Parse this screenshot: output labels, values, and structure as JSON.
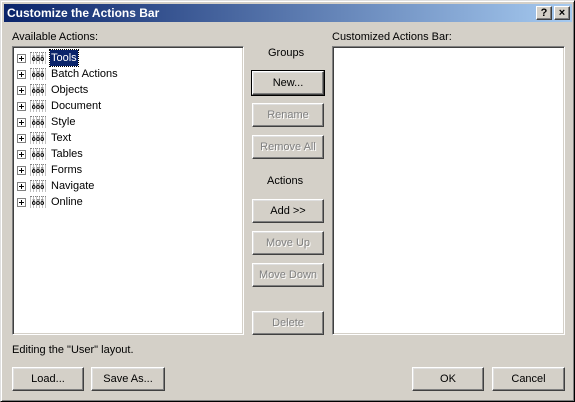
{
  "window": {
    "title": "Customize the Actions Bar",
    "help_glyph": "?",
    "close_glyph": "×"
  },
  "available": {
    "label": "Available Actions:",
    "items": [
      {
        "label": "Tools",
        "selected": true
      },
      {
        "label": "Batch Actions"
      },
      {
        "label": "Objects"
      },
      {
        "label": "Document"
      },
      {
        "label": "Style"
      },
      {
        "label": "Text"
      },
      {
        "label": "Tables"
      },
      {
        "label": "Forms"
      },
      {
        "label": "Navigate"
      },
      {
        "label": "Online"
      }
    ],
    "group_icon_glyph": "ŏőö"
  },
  "customized": {
    "label": "Customized Actions Bar:"
  },
  "groups": {
    "heading": "Groups",
    "new": "New...",
    "rename": "Rename",
    "remove_all": "Remove All"
  },
  "actions": {
    "heading": "Actions",
    "add": "Add  >>",
    "move_up": "Move Up",
    "move_down": "Move Down",
    "delete": "Delete"
  },
  "status": "Editing the \"User\" layout.",
  "footer": {
    "load": "Load...",
    "save_as": "Save As...",
    "ok": "OK",
    "cancel": "Cancel"
  }
}
